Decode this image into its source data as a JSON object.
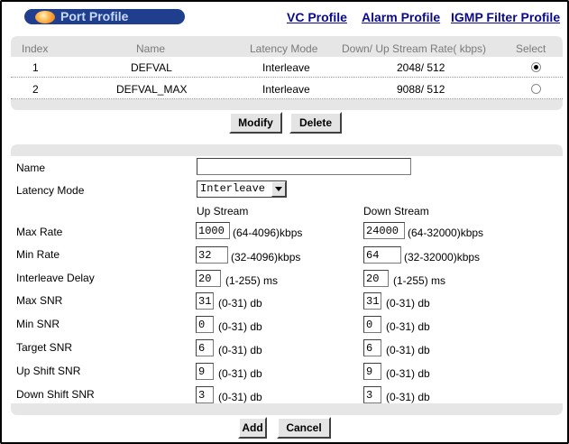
{
  "header": {
    "title": "Port Profile",
    "links": [
      "VC Profile",
      "Alarm Profile",
      "IGMP Filter Profile"
    ]
  },
  "profile_table": {
    "columns": [
      "Index",
      "Name",
      "Latency Mode",
      "Down/ Up Stream Rate( kbps)",
      "Select"
    ],
    "rows": [
      {
        "index": "1",
        "name": "DEFVAL",
        "latency": "Interleave",
        "rate": "2048/ 512",
        "selected": true
      },
      {
        "index": "2",
        "name": "DEFVAL_MAX",
        "latency": "Interleave",
        "rate": "9088/ 512",
        "selected": false
      }
    ]
  },
  "buttons": {
    "modify": "Modify",
    "delete": "Delete",
    "add": "Add",
    "cancel": "Cancel"
  },
  "form": {
    "name_label": "Name",
    "name_value": "",
    "latency_label": "Latency Mode",
    "latency_value": "Interleave",
    "up_header": "Up Stream",
    "down_header": "Down Stream",
    "fields": [
      {
        "label": "Max Rate",
        "up": "1000",
        "up_hint": "(64-4096)kbps",
        "down": "24000",
        "down_hint": "(64-32000)kbps"
      },
      {
        "label": "Min Rate",
        "up": "32",
        "up_hint": "(32-4096)kbps",
        "down": "64",
        "down_hint": "(32-32000)kbps"
      },
      {
        "label": "Interleave Delay",
        "up": "20",
        "up_hint": "(1-255) ms",
        "down": "20",
        "down_hint": "(1-255) ms"
      },
      {
        "label": "Max SNR",
        "up": "31",
        "up_hint": "(0-31) db",
        "down": "31",
        "down_hint": "(0-31) db"
      },
      {
        "label": "Min SNR",
        "up": "0",
        "up_hint": "(0-31) db",
        "down": "0",
        "down_hint": "(0-31) db"
      },
      {
        "label": "Target SNR",
        "up": "6",
        "up_hint": "(0-31) db",
        "down": "6",
        "down_hint": "(0-31) db"
      },
      {
        "label": "Up Shift SNR",
        "up": "9",
        "up_hint": "(0-31) db",
        "down": "9",
        "down_hint": "(0-31) db"
      },
      {
        "label": "Down Shift SNR",
        "up": "3",
        "up_hint": "(0-31) db",
        "down": "3",
        "down_hint": "(0-31) db"
      }
    ]
  },
  "colors": {
    "accent": "#1f3e8e",
    "link": "#0a0a8a",
    "panel": "#e6e6e6"
  }
}
